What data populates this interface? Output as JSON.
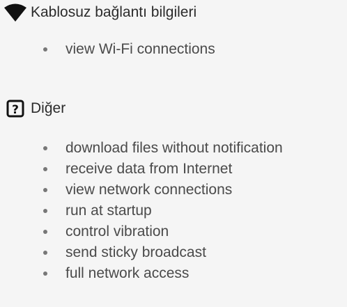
{
  "sections": [
    {
      "icon": "wifi-icon",
      "title": "Kablosuz bağlantı bilgileri",
      "items": [
        "view Wi-Fi connections"
      ]
    },
    {
      "icon": "question-mark-icon",
      "title": "Diğer",
      "items": [
        "download files without notification",
        "receive data from Internet",
        "view network connections",
        "run at startup",
        "control vibration",
        "send sticky broadcast",
        "full network access"
      ]
    }
  ]
}
